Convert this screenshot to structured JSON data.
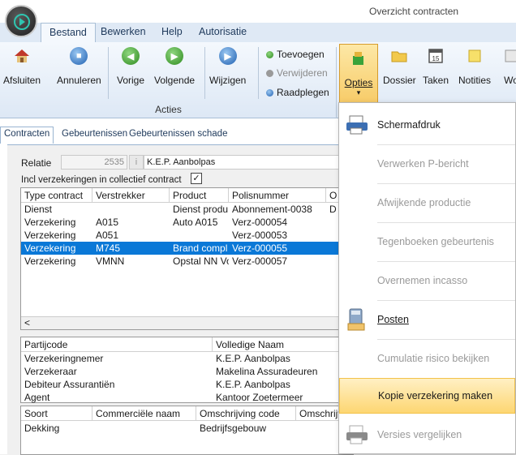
{
  "window": {
    "title": "Overzicht contracten"
  },
  "ribbon_tabs": [
    "Bestand",
    "Bewerken",
    "Help",
    "Autorisatie"
  ],
  "ribbon": {
    "buttons": [
      "Afsluiten",
      "Annuleren",
      "Vorige",
      "Volgende",
      "Wijzigen"
    ],
    "small_actions": [
      "Toevoegen",
      "Verwijderen",
      "Raadplegen"
    ],
    "group_label": "Acties",
    "right_buttons": [
      "Opties",
      "Dossier",
      "Taken",
      "Notities",
      "Wo"
    ],
    "calendar_day": "15"
  },
  "subtabs": [
    "Contracten",
    "Gebeurtenissen",
    "Gebeurtenissen schade"
  ],
  "relatie": {
    "label": "Relatie",
    "number": "2535",
    "name": "K.E.P. Aanbolpas"
  },
  "collectief": {
    "label": "Incl verzekeringen in collectief contract",
    "check": "✓"
  },
  "contracts": {
    "columns": [
      "Type contract",
      "Verstrekker",
      "Product",
      "Polisnummer",
      "O"
    ],
    "rows": [
      [
        "Dienst",
        "",
        "Dienst produ",
        "Abonnement-0038",
        "D"
      ],
      [
        "Verzekering",
        "A015",
        "Auto A015",
        "Verz-000054",
        ""
      ],
      [
        "Verzekering",
        "A051",
        "",
        "Verz-000053",
        ""
      ],
      [
        "Verzekering",
        "M745",
        "Brand compl",
        "Verz-000055",
        ""
      ],
      [
        "Verzekering",
        "VMNN",
        "Opstal NN Vo",
        "Verz-000057",
        ""
      ]
    ],
    "selected_index": 3,
    "scroll_left": "<"
  },
  "parties": {
    "columns": [
      "Partijcode",
      "Volledige Naam"
    ],
    "rows": [
      [
        "Verzekeringnemer",
        "K.E.P. Aanbolpas"
      ],
      [
        "Verzekeraar",
        "Makelina Assuradeuren"
      ],
      [
        "Debiteur Assurantiën",
        "K.E.P. Aanbolpas"
      ],
      [
        "Agent",
        "Kantoor Zoetermeer"
      ]
    ]
  },
  "coverage": {
    "columns": [
      "Soort",
      "Commerciële naam",
      "Omschrijving code",
      "Omschrijv"
    ],
    "rows": [
      [
        "Dekking",
        "",
        "Bedrijfsgebouw",
        ""
      ]
    ]
  },
  "menu": {
    "items": [
      {
        "label": "Schermafdruk",
        "disabled": false
      },
      {
        "label": "Verwerken P-bericht",
        "disabled": true
      },
      {
        "label": "Afwijkende productie",
        "disabled": true
      },
      {
        "label": "Tegenboeken gebeurtenis",
        "disabled": true
      },
      {
        "label": "Overnemen incasso",
        "disabled": true
      },
      {
        "label": "Posten",
        "disabled": false
      },
      {
        "label": "Cumulatie risico bekijken",
        "disabled": true
      },
      {
        "label": "Kopie verzekering maken",
        "disabled": false,
        "highlighted": true
      },
      {
        "label": "Versies vergelijken",
        "disabled": true
      }
    ]
  },
  "colors": {
    "accent": "#0a78d7",
    "ribbon_tab_bg": "#dfe9f5",
    "menu_highlight": "#fdd672"
  }
}
